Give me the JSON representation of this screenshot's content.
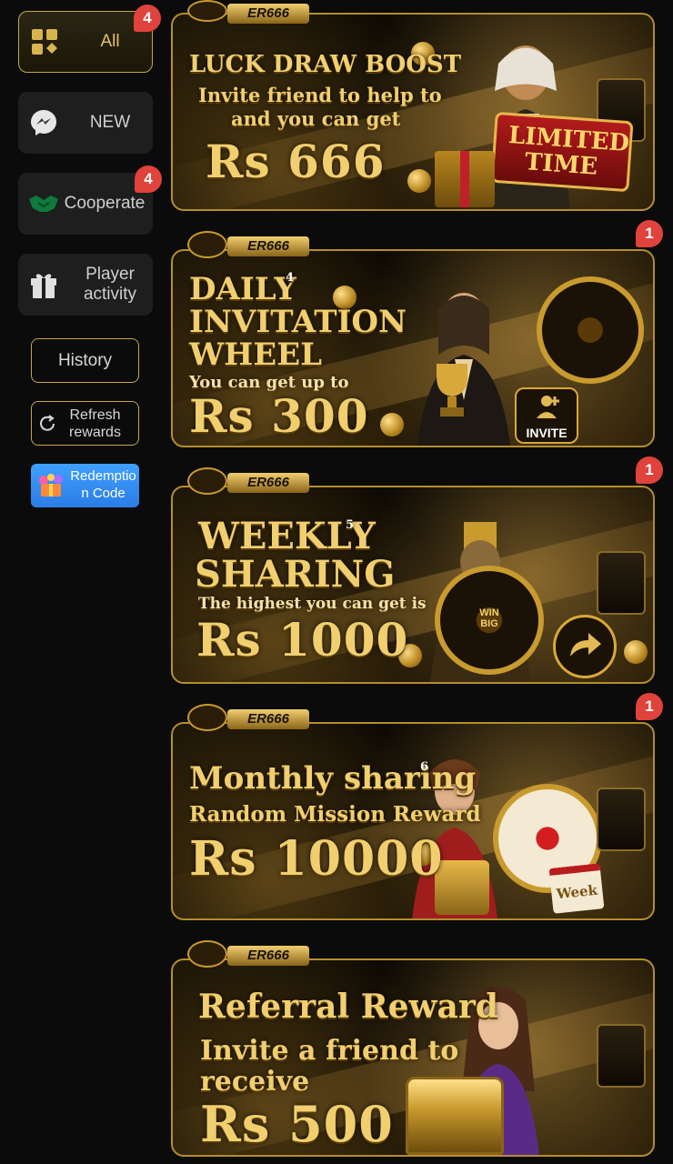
{
  "sidebar": {
    "items": [
      {
        "label": "All",
        "badge": "4"
      },
      {
        "label": "NEW"
      },
      {
        "label": "Cooperate",
        "badge": "4"
      },
      {
        "label": "Player activity"
      }
    ],
    "history_label": "History",
    "refresh_label": "Refresh rewards",
    "redeem_label": "Redemption Code"
  },
  "banners": [
    {
      "brand": "ER666",
      "title": "LUCK DRAW BOOST",
      "line1": "Invite friend to help to",
      "line2": "and you can get",
      "amount": "Rs 666",
      "tag": "LIMITED TIME",
      "badge": ""
    },
    {
      "brand": "ER666",
      "title1": "DAILY",
      "title2": "INVITATION",
      "title3": "WHEEL",
      "step": "4",
      "line1": "You can get up to",
      "amount": "Rs 300",
      "cta": "INVITE",
      "badge": "1"
    },
    {
      "brand": "ER666",
      "title1": "WEEKLY",
      "title2": "SHARING",
      "step": "5",
      "line1": "The highest you can get is",
      "amount": "Rs 1000",
      "wheel_center": "WIN BIG",
      "badge": "1"
    },
    {
      "brand": "ER666",
      "title": "Monthly sharing",
      "step": "6",
      "line1": "Random Mission Reward",
      "amount": "Rs 10000",
      "tag": "Week",
      "badge": "1"
    },
    {
      "brand": "ER666",
      "title": "Referral Reward",
      "line1": "Invite a friend to",
      "line2": "receive",
      "amount": "Rs 500"
    }
  ],
  "colors": {
    "gold": "#c7a447",
    "badge": "#e0423c",
    "redeem": "#2b7de6"
  }
}
